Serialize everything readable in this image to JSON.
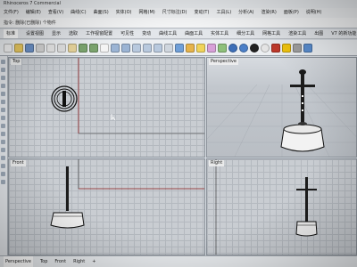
{
  "window": {
    "title": "Rhinoceros 7 Commercial"
  },
  "menu": [
    "文件(F)",
    "编辑(E)",
    "查看(V)",
    "曲线(C)",
    "曲面(S)",
    "实体(O)",
    "网格(M)",
    "尺寸标注(D)",
    "变动(T)",
    "工具(L)",
    "分析(A)",
    "渲染(R)",
    "面板(P)",
    "说明(H)"
  ],
  "command": {
    "prompt": "指令: 删除(已删除) 个物件"
  },
  "tabs": [
    "标准",
    "设置视图",
    "显示",
    "选取",
    "工作视窗配置",
    "可见性",
    "变动",
    "曲线工具",
    "曲面工具",
    "实体工具",
    "细分工具",
    "网格工具",
    "渲染工具",
    "出图",
    "V7 的新功能"
  ],
  "active_tab": "标准",
  "viewports": {
    "top": "Top",
    "perspective": "Perspective",
    "front": "Front",
    "right": "Right"
  },
  "bottom_tabs": [
    "Perspective",
    "Top",
    "Front",
    "Right",
    "+"
  ],
  "colors": {
    "grid": "#b4b9bf",
    "viewport_bg": "#c9cdd2",
    "active_label": "#ffffff"
  }
}
